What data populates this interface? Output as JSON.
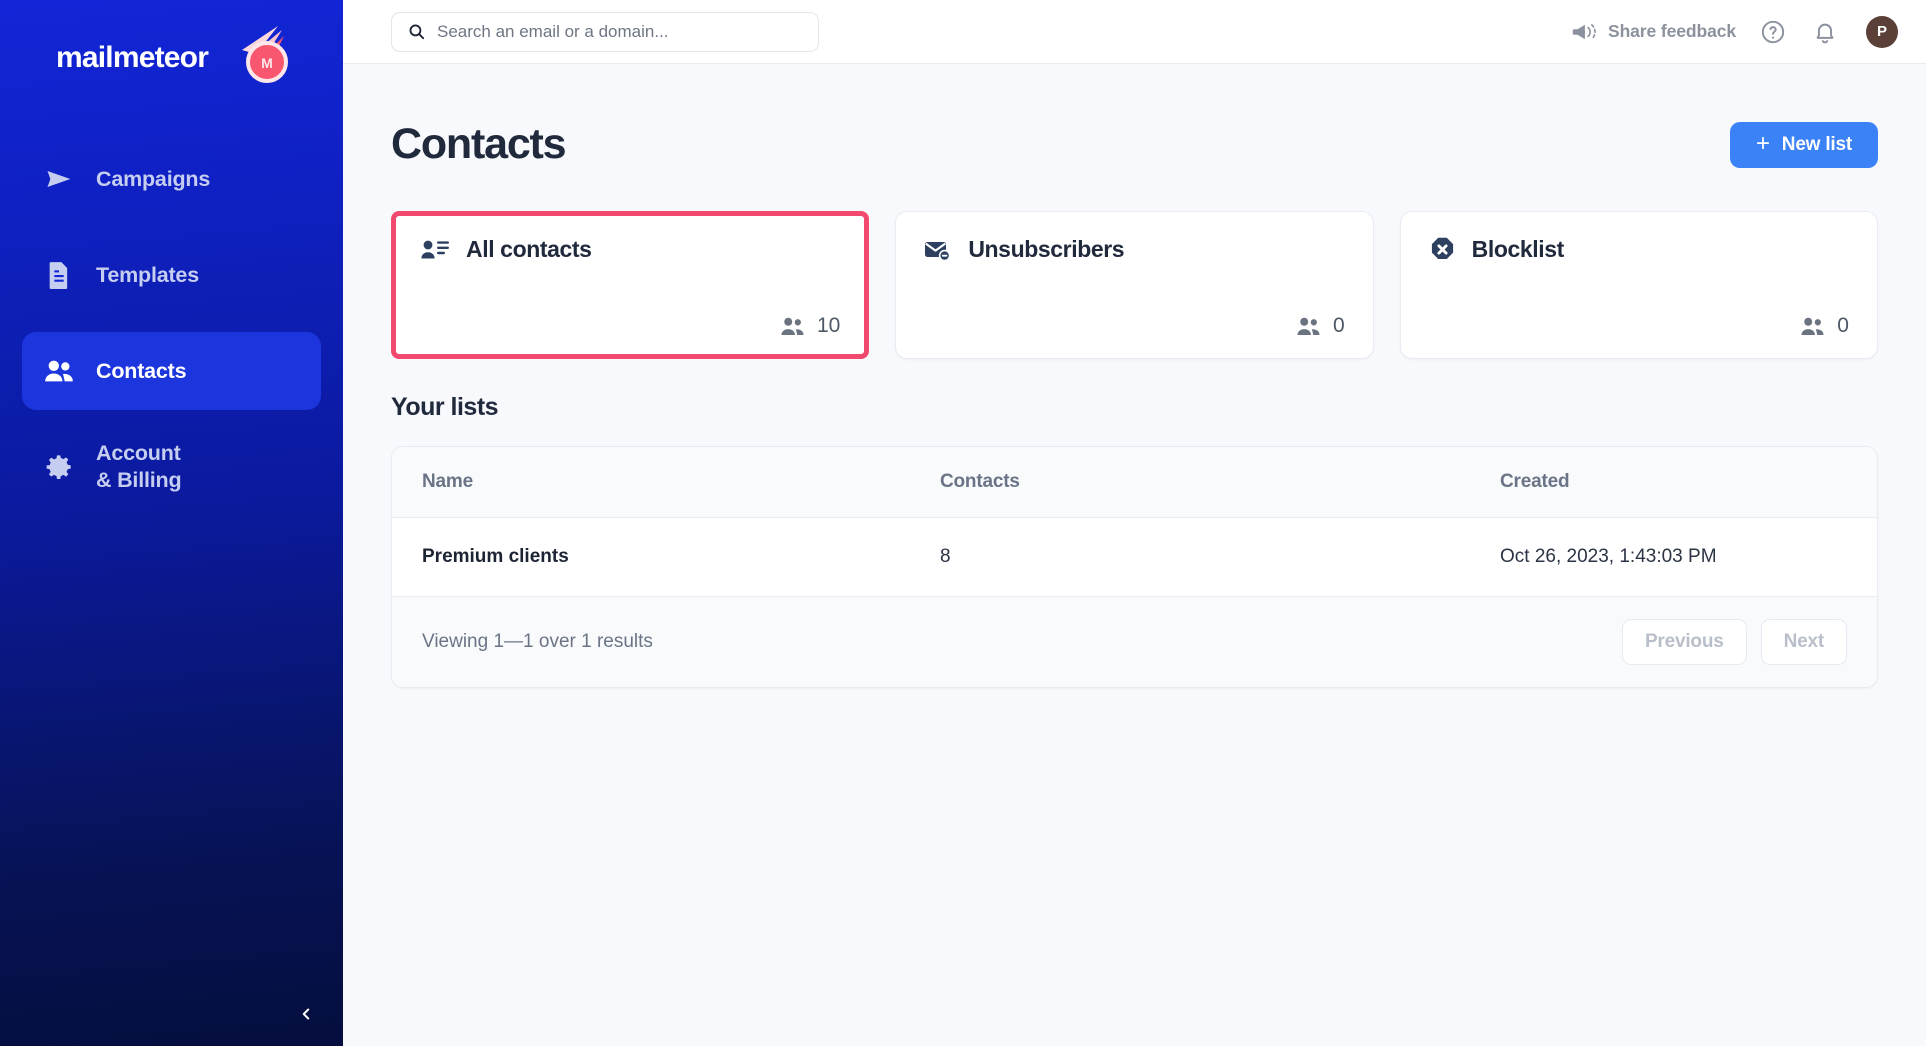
{
  "sidebar": {
    "logo_text": "mailmeteor",
    "logo_icon": "comet-icon",
    "items": [
      {
        "label": "Campaigns",
        "icon": "send-icon",
        "active": false
      },
      {
        "label": "Templates",
        "icon": "document-icon",
        "active": false
      },
      {
        "label": "Contacts",
        "icon": "people-icon",
        "active": true
      },
      {
        "label": "Account\n& Billing",
        "icon": "gear-icon",
        "active": false
      }
    ],
    "collapse_icon": "chevron-left-icon"
  },
  "topbar": {
    "search": {
      "placeholder": "Search an email or a domain...",
      "value": "",
      "icon": "search-icon"
    },
    "feedback_label": "Share feedback",
    "feedback_icon": "megaphone-icon",
    "help_icon": "help-circle-icon",
    "bell_icon": "bell-icon",
    "avatar_initial": "P"
  },
  "page": {
    "title": "Contacts",
    "new_list_label": "New list",
    "new_list_plus": "+"
  },
  "cards": [
    {
      "title": "All contacts",
      "count": "10",
      "icon": "contact-card-icon",
      "highlighted": true
    },
    {
      "title": "Unsubscribers",
      "count": "0",
      "icon": "envelope-minus-icon",
      "highlighted": false
    },
    {
      "title": "Blocklist",
      "count": "0",
      "icon": "block-x-icon",
      "highlighted": false
    }
  ],
  "lists": {
    "section_title": "Your lists",
    "columns": [
      "Name",
      "Contacts",
      "Created"
    ],
    "rows": [
      {
        "name": "Premium clients",
        "contacts": "8",
        "created": "Oct 26, 2023, 1:43:03 PM"
      }
    ],
    "footer_text": "Viewing 1—1 over 1 results",
    "previous_label": "Previous",
    "next_label": "Next"
  },
  "colors": {
    "sidebar_top": "#1226d8",
    "sidebar_bottom": "#050e3d",
    "accent_blue": "#3b82f6",
    "highlight_red": "#f2496e",
    "avatar_brown": "#5b4037",
    "title_dark": "#212a3c"
  }
}
